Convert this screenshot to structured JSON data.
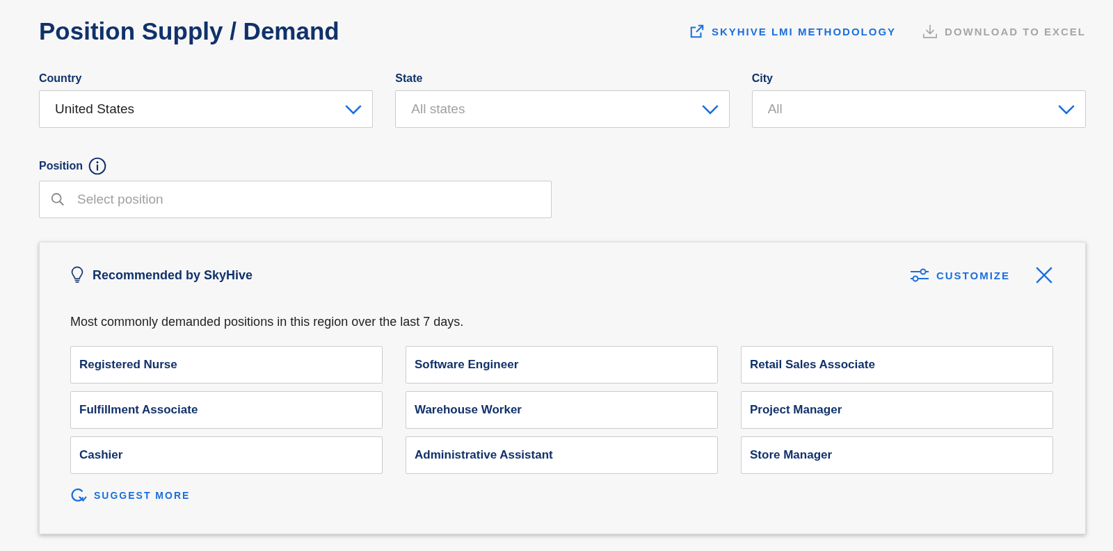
{
  "page": {
    "title": "Position Supply / Demand"
  },
  "actions": [
    {
      "kind": "external",
      "label": "SKYHIVE LMI METHODOLOGY",
      "disabled": false
    },
    {
      "kind": "download",
      "label": "DOWNLOAD TO EXCEL",
      "disabled": true
    }
  ],
  "filters": [
    {
      "label": "Country",
      "value": "United States"
    },
    {
      "label": "State",
      "placeholder": "All states"
    },
    {
      "label": "City",
      "placeholder": "All"
    }
  ],
  "position": {
    "label": "Position",
    "placeholder": "Select position"
  },
  "recommendations": {
    "title": "Recommended by SkyHive",
    "customize": "CUSTOMIZE",
    "description": "Most commonly demanded positions in this region over the last 7 days.",
    "positions": [
      "Registered Nurse",
      "Software Engineer",
      "Retail Sales Associate",
      "Fulfillment Associate",
      "Warehouse Worker",
      "Project Manager",
      "Cashier",
      "Administrative Assistant",
      "Store Manager"
    ],
    "suggest_more": "SUGGEST MORE"
  }
}
